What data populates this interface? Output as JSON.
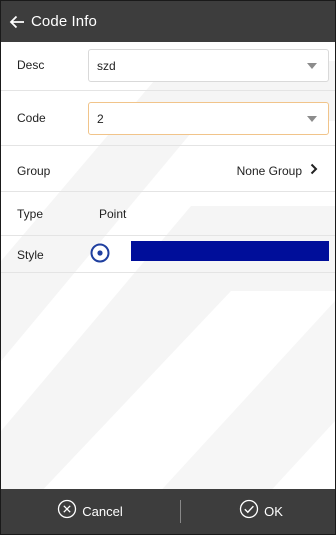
{
  "header": {
    "title": "Code Info",
    "back_icon": "back-arrow-icon"
  },
  "form": {
    "desc": {
      "label": "Desc",
      "value": "szd"
    },
    "code": {
      "label": "Code",
      "value": "2"
    },
    "group": {
      "label": "Group",
      "value": "None Group"
    },
    "type": {
      "label": "Type",
      "value": "Point"
    },
    "style": {
      "label": "Style",
      "color": "#000e9a",
      "radio_color": "#1f3f9f"
    }
  },
  "footer": {
    "cancel_label": "Cancel",
    "ok_label": "OK"
  },
  "colors": {
    "header_bg": "#3d3d3d",
    "footer_bg": "#3d3d3d",
    "focus_border": "#f1c48a"
  }
}
